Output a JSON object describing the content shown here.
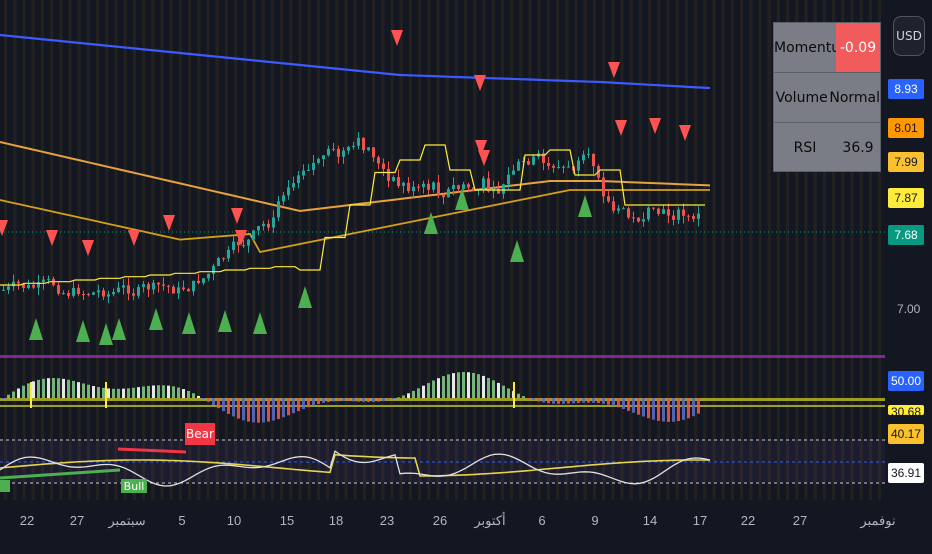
{
  "currency_button": {
    "label": "USD"
  },
  "info_table": [
    {
      "key": "Momentum",
      "value": "-0.09",
      "negative": true
    },
    {
      "key": "Volume",
      "value": "Normal",
      "negative": false
    },
    {
      "key": "RSI",
      "value": "36.9",
      "negative": false
    }
  ],
  "price_tags": [
    {
      "label": "8.93",
      "bg": "#2962ff",
      "fg": "#ffffff"
    },
    {
      "label": "8.01",
      "bg": "#ff9800",
      "fg": "#131722"
    },
    {
      "label": "7.99",
      "bg": "#fbc02d",
      "fg": "#131722"
    },
    {
      "label": "7.87",
      "bg": "#ffeb3b",
      "fg": "#131722"
    },
    {
      "label": "7.68",
      "bg": "#089981",
      "fg": "#ffffff"
    }
  ],
  "price_axis": {
    "label_7": "7.00"
  },
  "osc_tags": [
    {
      "label": "50.00",
      "bg": "#2962ff",
      "fg": "#ffffff"
    },
    {
      "label": "30.68",
      "bg": "#ffeb3b",
      "fg": "#131722"
    }
  ],
  "rsi_tags": [
    {
      "label": "40.17",
      "bg": "#fbc02d",
      "fg": "#131722"
    },
    {
      "label": "36.91",
      "bg": "#ffffff",
      "fg": "#131722"
    }
  ],
  "signals": {
    "bear": "Bear",
    "bull": "Bull"
  },
  "x_axis": [
    "22",
    "27",
    "سبتمبر",
    "5",
    "10",
    "15",
    "18",
    "23",
    "26",
    "أكتوبر",
    "6",
    "9",
    "14",
    "17",
    "22",
    "27",
    "نوفمبر"
  ],
  "chart_data": {
    "type": "candlestick",
    "y_unit": "USD",
    "last_price": 7.68,
    "moving_averages": [
      {
        "color": "#2962ff",
        "value": 8.93
      },
      {
        "color": "#ff9800",
        "value": 8.01
      },
      {
        "color": "#fbc02d",
        "value": 7.99
      },
      {
        "color": "#ffeb3b",
        "value": 7.87
      }
    ],
    "rsi": {
      "value": 36.91,
      "signal": 40.17
    }
  }
}
